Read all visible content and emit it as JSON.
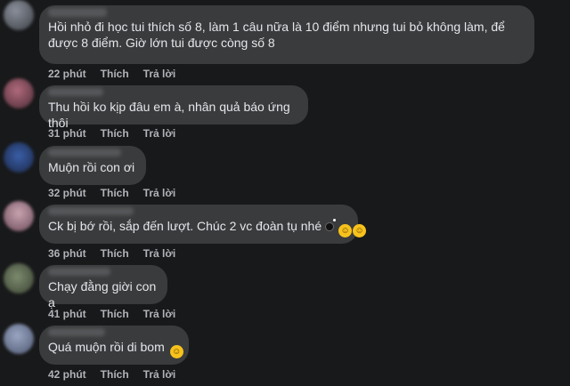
{
  "labels": {
    "like": "Thích",
    "reply": "Trả lời"
  },
  "comments": [
    {
      "text": "Hồi nhỏ đi học tui thích số 8, làm 1 câu nữa là 10 điểm nhưng tui bỏ không làm, để được 8 điểm. Giờ lớn tui được còng số 8",
      "time": "22 phút"
    },
    {
      "text": "Thu hồi ko kịp đâu em à, nhân quả báo ứng thôi",
      "time": "31 phút"
    },
    {
      "text": "Muộn rồi con ơi",
      "time": "32 phút"
    },
    {
      "text": "Ck bị bớ rồi, sắp đến lượt. Chúc 2 vc đoàn tụ nhé",
      "time": "36 phút",
      "icons": [
        "bomb-icon",
        "rofl-emoji-icon",
        "rofl-emoji-icon"
      ]
    },
    {
      "text": "Chạy đằng giời con ạ",
      "time": "41 phút"
    },
    {
      "text": "Quá muộn rồi di bom",
      "time": "42 phút",
      "icons": [
        "smile-emoji-icon"
      ]
    }
  ],
  "colors": {
    "background": "#18191a",
    "bubble": "#3a3b3c",
    "text": "#e4e6eb",
    "meta": "#b0b3b8"
  }
}
